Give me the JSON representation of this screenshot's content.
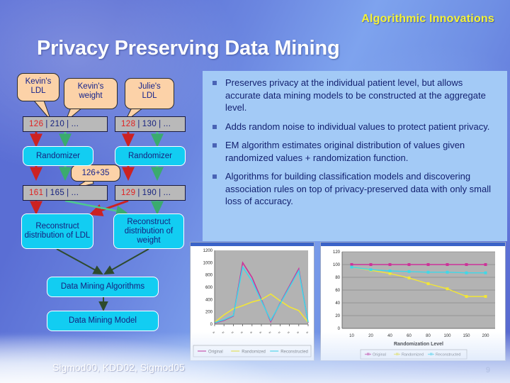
{
  "header": {
    "kicker": "Algorithmic Innovations",
    "title": "Privacy Preserving Data Mining"
  },
  "diagram": {
    "callouts": [
      {
        "id": "kevin-ldl",
        "line1": "Kevin's",
        "line2": "LDL"
      },
      {
        "id": "kevin-weight",
        "line1": "Kevin's",
        "line2": "weight"
      },
      {
        "id": "julie-ldl",
        "line1": "Julie's",
        "line2": "LDL"
      },
      {
        "id": "noise",
        "line1": "126+35",
        "line2": ""
      }
    ],
    "data_rows": [
      {
        "id": "kevin-original",
        "first": "126",
        "rest": "210",
        "ellipsis": "..."
      },
      {
        "id": "julie-original",
        "first": "128",
        "rest": "130",
        "ellipsis": "..."
      },
      {
        "id": "kevin-randomized",
        "first": "161",
        "rest": "165",
        "ellipsis": "..."
      },
      {
        "id": "julie-randomized",
        "first": "129",
        "rest": "190",
        "ellipsis": "..."
      }
    ],
    "process_boxes": [
      {
        "id": "randomizer-left",
        "label": "Randomizer"
      },
      {
        "id": "randomizer-right",
        "label": "Randomizer"
      },
      {
        "id": "reconstruct-ldl",
        "label": "Reconstruct distribution of LDL"
      },
      {
        "id": "reconstruct-weight",
        "label": "Reconstruct distribution of weight"
      },
      {
        "id": "dm-algorithms",
        "label": "Data Mining Algorithms"
      },
      {
        "id": "dm-model",
        "label": "Data Mining Model"
      }
    ]
  },
  "bullets": [
    "Preserves privacy at the individual patient level, but allows accurate data mining models to be constructed at the aggregate level.",
    "Adds random noise to individual values to protect patient privacy.",
    "EM algorithm estimates original distribution of values given randomized values + randomization function.",
    "Algorithms for building classification models and discovering association rules on top of privacy-preserved data with only small loss of accuracy."
  ],
  "colors": {
    "accent_yellow": "#f4f336",
    "panel_blue": "#a3caf6",
    "cyan_box": "#12cdf2",
    "callout_peach": "#fcd2a8",
    "series_original": "#cc3399",
    "series_randomized": "#f2e636",
    "series_reconstructed": "#3fd8e8"
  },
  "footer": {
    "references": "Sigmod00, KDD02, Sigmod05",
    "page_number": "9"
  },
  "chart_data": [
    {
      "id": "distribution-chart",
      "type": "line",
      "title": "",
      "xlabel": "",
      "ylabel": "",
      "ylim": [
        0,
        1200
      ],
      "yticks": [
        0,
        200,
        400,
        600,
        800,
        1000,
        1200
      ],
      "grid": false,
      "legend_position": "bottom",
      "x": [
        1,
        2,
        3,
        4,
        5,
        6,
        7,
        8,
        9,
        10,
        11
      ],
      "series": [
        {
          "name": "Original",
          "color": "#cc3399",
          "values": [
            20,
            60,
            130,
            1000,
            760,
            400,
            40,
            340,
            620,
            900,
            20
          ]
        },
        {
          "name": "Randomized",
          "color": "#f2e636",
          "values": [
            30,
            150,
            250,
            300,
            360,
            400,
            490,
            380,
            280,
            220,
            30
          ]
        },
        {
          "name": "Reconstructed",
          "color": "#3fd8e8",
          "values": [
            25,
            70,
            140,
            930,
            700,
            380,
            60,
            330,
            600,
            870,
            30
          ]
        }
      ]
    },
    {
      "id": "accuracy-chart",
      "type": "line",
      "title": "",
      "xlabel": "Randomization Level",
      "ylabel": "",
      "ylim": [
        0,
        120
      ],
      "yticks": [
        0,
        20,
        40,
        60,
        80,
        100,
        120
      ],
      "grid": true,
      "legend_position": "bottom",
      "categories": [
        "10",
        "20",
        "40",
        "60",
        "80",
        "100",
        "150",
        "200"
      ],
      "series": [
        {
          "name": "Original",
          "color": "#cc3399",
          "values": [
            100,
            100,
            100,
            100,
            100,
            100,
            100,
            100
          ]
        },
        {
          "name": "Randomized",
          "color": "#f2e636",
          "values": [
            96,
            91,
            86,
            79,
            70,
            62,
            50,
            50
          ]
        },
        {
          "name": "Reconstructed",
          "color": "#3fd8e8",
          "values": [
            96,
            92,
            90,
            89,
            88,
            88,
            87,
            87
          ]
        }
      ]
    }
  ]
}
